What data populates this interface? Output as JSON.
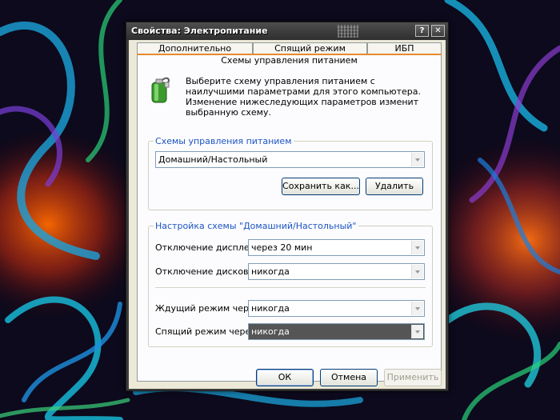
{
  "window": {
    "title": "Свойства: Электропитание",
    "help_button": "?",
    "close_button": "✕"
  },
  "tabs": {
    "row1": [
      "Дополнительно",
      "Спящий режим",
      "ИБП"
    ],
    "active": "Схемы управления питанием"
  },
  "intro_text": "Выберите схему управления питанием с наилучшими параметрами для этого компьютера. Изменение нижеследующих параметров изменит выбранную схему.",
  "schemes_group": {
    "legend": "Схемы управления питанием",
    "selected": "Домашний/Настольный",
    "save_as_label": "Сохранить как...",
    "delete_label": "Удалить"
  },
  "settings_group": {
    "legend": "Настройка схемы \"Домашний/Настольный\"",
    "rows": [
      {
        "label": "Отключение дисплея:",
        "value": "через 20 мин"
      },
      {
        "label": "Отключение дисков:",
        "value": "никогда"
      },
      {
        "label": "Ждущий режим через:",
        "value": "никогда"
      },
      {
        "label": "Спящий режим через:",
        "value": "никогда"
      }
    ]
  },
  "footer": {
    "ok": "ОК",
    "cancel": "Отмена",
    "apply": "Применить"
  }
}
